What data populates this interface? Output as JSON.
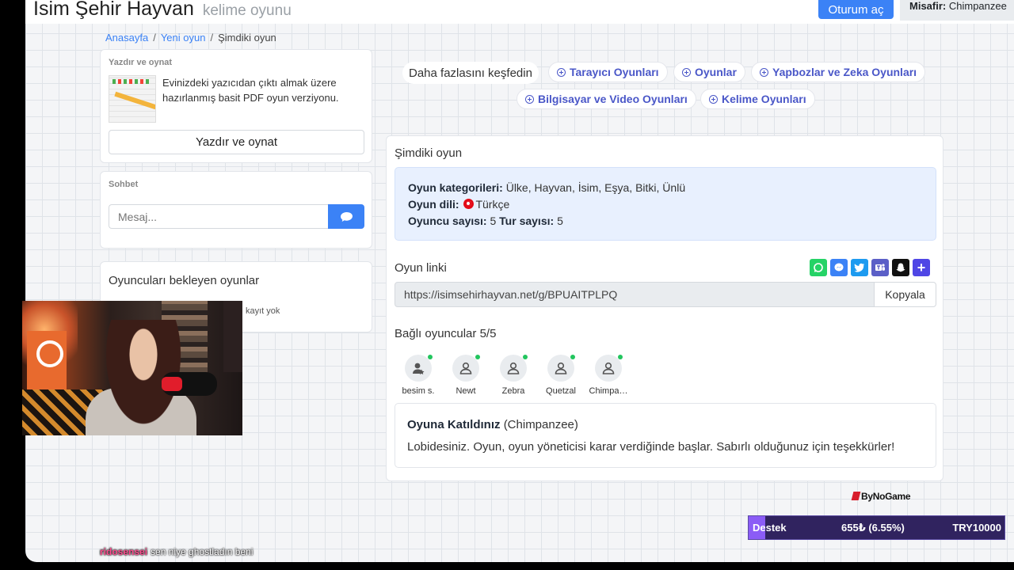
{
  "header": {
    "brand": "Isim Şehir Hayvan",
    "brand_sub": "kelime oyunu",
    "login_label": "Oturum aç",
    "guest_label": "Misafir:",
    "guest_name": "Chimpanzee"
  },
  "breadcrumb": {
    "home": "Anasayfa",
    "new_game": "Yeni oyun",
    "current": "Şimdiki oyun"
  },
  "print": {
    "title": "Yazdır ve oynat",
    "description": "Evinizdeki yazıcıdan çıktı almak üzere hazırlanmış basit PDF oyun verziyonu.",
    "button": "Yazdır ve oynat"
  },
  "chat": {
    "title": "Sohbet",
    "placeholder": "Mesaj..."
  },
  "waiting": {
    "title": "Oyuncuları bekleyen oyunlar",
    "empty": "kayıt yok"
  },
  "explore": {
    "label": "Daha fazlasını keşfedin",
    "chips": [
      "Tarayıcı Oyunları",
      "Oyunlar",
      "Yapbozlar ve Zeka Oyunları",
      "Bilgisayar ve Video Oyunları",
      "Kelime Oyunları"
    ]
  },
  "game": {
    "title": "Şimdiki oyun",
    "categories_label": "Oyun kategorileri:",
    "categories_value": "Ülke, Hayvan, İsim, Eşya, Bitki, Ünlü",
    "language_label": "Oyun dili:",
    "language_value": "Türkçe",
    "players_label": "Oyuncu sayısı:",
    "players_value": "5",
    "rounds_label": "Tur sayısı:",
    "rounds_value": "5",
    "link_label": "Oyun linki",
    "link_url": "https://isimsehirhayvan.net/g/BPUAITPLPQ",
    "copy_label": "Kopyala",
    "share_icons": [
      "whatsapp-icon",
      "messenger-icon",
      "twitter-icon",
      "teams-icon",
      "snapchat-icon",
      "plus-icon"
    ],
    "connected_label": "Bağlı oyuncular 5/5",
    "players": [
      {
        "name": "besim s.",
        "icon": "admin-user-icon"
      },
      {
        "name": "Newt",
        "icon": "user-icon"
      },
      {
        "name": "Zebra",
        "icon": "user-icon"
      },
      {
        "name": "Quetzal",
        "icon": "user-icon"
      },
      {
        "name": "Chimpa…",
        "icon": "user-icon"
      }
    ],
    "joined_title": "Oyuna Katıldınız",
    "joined_name": "(Chimpanzee)",
    "joined_message": "Lobidesiniz. Oyun, oyun yöneticisi karar verdiğinde başlar. Sabırlı olduğunuz için teşekkürler!"
  },
  "overlay": {
    "sponsor": "ByNoGame",
    "support_label": "Destek",
    "support_amount": "655₺ (6.55%)",
    "support_goal": "TRY10000",
    "support_progress": 0.0655,
    "chat_user": "ridosensei",
    "chat_text": "sen niye ghostladın beni"
  },
  "colors": {
    "accent": "#3b82f6",
    "chip_text": "#4a57c8",
    "online": "#22c55e",
    "info_bg": "#e8f0fe"
  }
}
